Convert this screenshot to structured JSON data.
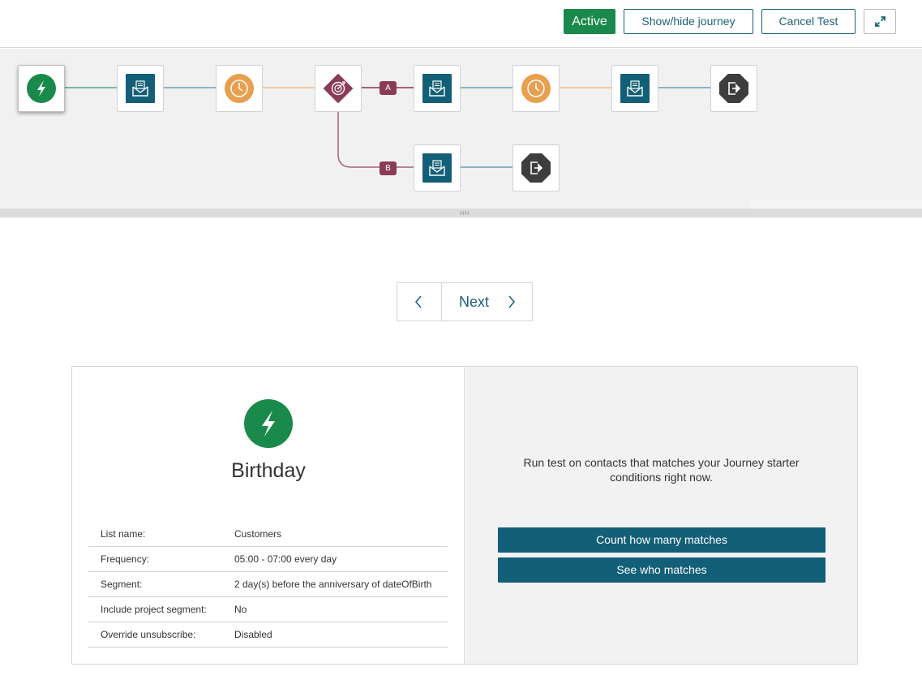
{
  "toolbar": {
    "status": "Active",
    "show_hide_label": "Show/hide journey",
    "cancel_label": "Cancel Test",
    "expand_icon": "expand-icon"
  },
  "journey": {
    "branch_a_label": "A",
    "branch_b_label": "B",
    "nodes": [
      "starter",
      "email",
      "wait",
      "split",
      "email",
      "wait",
      "email",
      "exit",
      "email",
      "exit"
    ],
    "colors": {
      "starter": "#198a4b",
      "email": "#135f77",
      "wait": "#e6a04f",
      "split": "#8a3b57",
      "exit": "#3d3d3d"
    }
  },
  "pager": {
    "next_label": "Next"
  },
  "starter": {
    "title": "Birthday",
    "properties": [
      {
        "label": "List name:",
        "value": "Customers"
      },
      {
        "label": "Frequency:",
        "value": "05:00 - 07:00 every day"
      },
      {
        "label": "Segment:",
        "value": "2 day(s) before the anniversary of dateOfBirth"
      },
      {
        "label": "Include project segment:",
        "value": "No"
      },
      {
        "label": "Override unsubscribe:",
        "value": "Disabled"
      }
    ]
  },
  "test": {
    "description": "Run test on contacts that matches your Journey starter conditions right now.",
    "count_label": "Count how many matches",
    "see_label": "See who matches"
  }
}
